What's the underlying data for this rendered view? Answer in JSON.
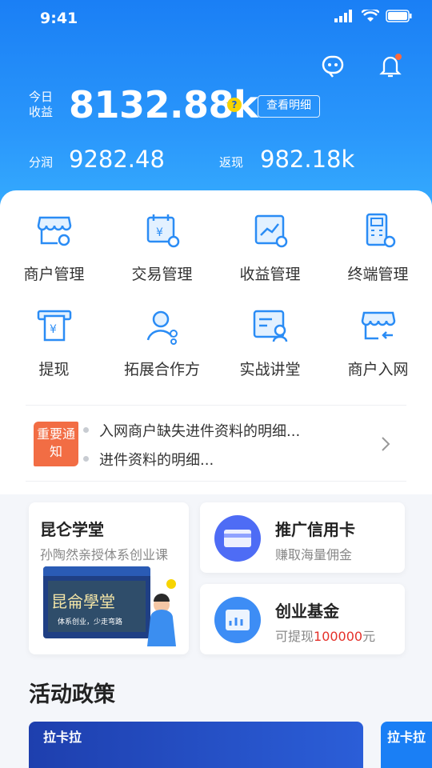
{
  "status": {
    "time": "9:41"
  },
  "earnings": {
    "today_label": "今日收益",
    "today_value": "8132.88k",
    "help": "?",
    "detail_button": "查看明细",
    "share_label": "分润",
    "share_value": "9282.48",
    "cashback_label": "返现",
    "cashback_value": "982.18k"
  },
  "top_icons": [
    "customer-service-icon",
    "notification-bell-icon"
  ],
  "grid": [
    {
      "label": "商户管理",
      "icon": "merchant-manage-icon"
    },
    {
      "label": "交易管理",
      "icon": "transaction-manage-icon"
    },
    {
      "label": "收益管理",
      "icon": "income-manage-icon"
    },
    {
      "label": "终端管理",
      "icon": "terminal-manage-icon"
    },
    {
      "label": "提现",
      "icon": "withdraw-icon"
    },
    {
      "label": "拓展合作方",
      "icon": "partner-expand-icon"
    },
    {
      "label": "实战讲堂",
      "icon": "lecture-icon"
    },
    {
      "label": "商户入网",
      "icon": "merchant-onboard-icon"
    }
  ],
  "notice": {
    "badge": "重要通知",
    "lines": [
      "入网商户缺失进件资料的明细...",
      "进件资料的明细..."
    ]
  },
  "promos": {
    "academy": {
      "title": "昆仑学堂",
      "subtitle": "孙陶然亲授体系创业课",
      "board_text": "昆侖學堂",
      "board_sub": "体系创业，少走弯路"
    },
    "credit_card": {
      "title": "推广信用卡",
      "subtitle": "赚取海量佣金"
    },
    "fund": {
      "title": "创业基金",
      "subtitle_prefix": "可提现",
      "amount": "100000",
      "subtitle_suffix": "元"
    }
  },
  "section_title": "活动政策",
  "banners": {
    "brand": "拉卡拉"
  },
  "colors": {
    "primary": "#1a7ff5",
    "accent_red": "#e5312a",
    "badge": "#f26d44"
  }
}
